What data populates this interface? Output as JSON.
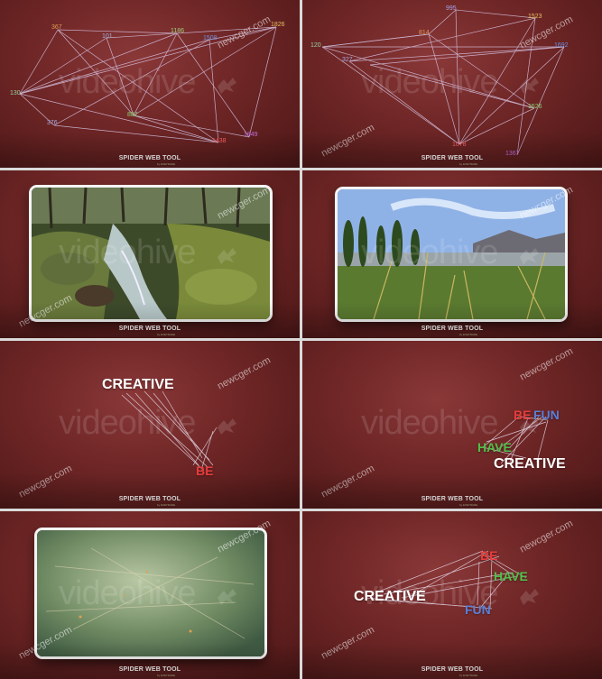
{
  "product_title": "SPIDER WEB TOOL",
  "byline": "by EXETRADE",
  "watermark": "videohive",
  "site_watermark": "newcger.com",
  "colors": {
    "background": "#6f2626",
    "line": "#d7c6e6"
  },
  "panels": [
    {
      "id": "p1",
      "type": "numbers",
      "nodes": [
        "367",
        "101",
        "1186",
        "1508",
        "1826",
        "130",
        "376",
        "882",
        "1438",
        "1849"
      ],
      "node_colors": [
        "#e09a55",
        "#9fb0d8",
        "#9fcf7a",
        "#6f8fe0",
        "#e6c060",
        "#9ad0a0",
        "#a7a9e0",
        "#8fd070",
        "#ff6060",
        "#c070e0"
      ]
    },
    {
      "id": "p2",
      "type": "numbers",
      "nodes": [
        "995",
        "814",
        "1523",
        "120",
        "1692",
        "327",
        "1526",
        "1078",
        "1367"
      ],
      "node_colors": [
        "#a4a4e8",
        "#e09a55",
        "#e6c060",
        "#9ad0a0",
        "#6f8fe0",
        "#a7a9e0",
        "#8fd070",
        "#ff6060",
        "#c070e0"
      ]
    },
    {
      "id": "p3",
      "type": "photo",
      "scene": "forest-stream"
    },
    {
      "id": "p4",
      "type": "photo",
      "scene": "lake-reeds"
    },
    {
      "id": "p5",
      "type": "words",
      "words": [
        {
          "text": "CREATIVE",
          "color": "#ffffff"
        },
        {
          "text": "BE",
          "color": "#e83c3c"
        }
      ]
    },
    {
      "id": "p6",
      "type": "words",
      "words": [
        {
          "text": "BE",
          "color": "#e83c3c"
        },
        {
          "text": "FUN",
          "color": "#5a7fd6"
        },
        {
          "text": "HAVE",
          "color": "#4fc04a"
        },
        {
          "text": "CREATIVE",
          "color": "#ffffff"
        }
      ]
    },
    {
      "id": "p7",
      "type": "photo",
      "scene": "underwater"
    },
    {
      "id": "p8",
      "type": "words",
      "words": [
        {
          "text": "BE",
          "color": "#e83c3c"
        },
        {
          "text": "HAVE",
          "color": "#4fc04a"
        },
        {
          "text": "CREATIVE",
          "color": "#ffffff"
        },
        {
          "text": "FUN",
          "color": "#5a7fd6"
        }
      ]
    }
  ]
}
